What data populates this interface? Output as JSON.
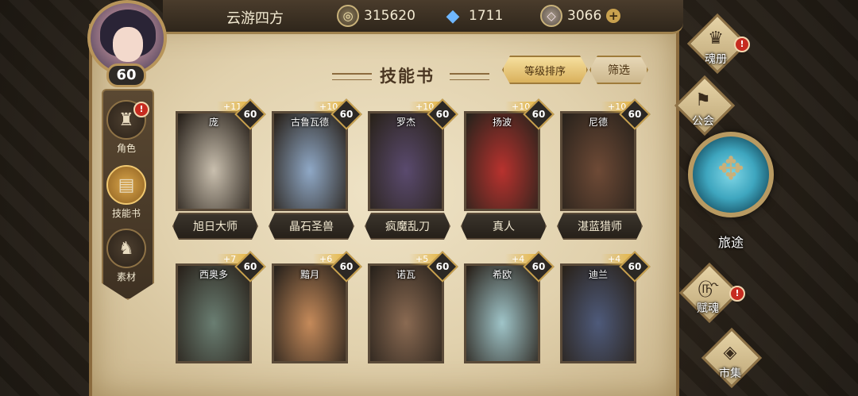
{
  "player": {
    "name": "云游四方",
    "level": "60"
  },
  "resources": {
    "gold": {
      "icon": "coin-icon",
      "value": "315620"
    },
    "crystal": {
      "icon": "blue-crystal-icon",
      "value": "1711"
    },
    "gem": {
      "icon": "gem-icon",
      "value": "3066"
    },
    "plus": "+"
  },
  "side_menu": [
    {
      "label": "角色",
      "icon": "helmet-icon",
      "alert": "!"
    },
    {
      "label": "技能书",
      "icon": "book-icon"
    },
    {
      "label": "素材",
      "icon": "wolf-icon"
    }
  ],
  "page": {
    "title": "技能书",
    "sort_label": "等级排序",
    "filter_label": "筛选"
  },
  "cards": [
    {
      "hero": "庞",
      "plus": "+11",
      "level": "60",
      "book": "旭日大师",
      "color": "#c9bfae"
    },
    {
      "hero": "古鲁瓦德",
      "plus": "+10",
      "level": "60",
      "book": "晶石圣兽",
      "color": "#8fa8c6"
    },
    {
      "hero": "罗杰",
      "plus": "+10",
      "level": "60",
      "book": "疯魔乱刀",
      "color": "#5a4a6e"
    },
    {
      "hero": "扬波",
      "plus": "+10",
      "level": "60",
      "book": "真人",
      "color": "#b8322e"
    },
    {
      "hero": "尼德",
      "plus": "+10",
      "level": "60",
      "book": "湛蓝猎师",
      "color": "#6e4a36"
    },
    {
      "hero": "西奥多",
      "plus": "+7",
      "level": "60",
      "color": "#6a7e72"
    },
    {
      "hero": "黯月",
      "plus": "+6",
      "level": "60",
      "color": "#c58a5a"
    },
    {
      "hero": "诺瓦",
      "plus": "+5",
      "level": "60",
      "color": "#8a6a52"
    },
    {
      "hero": "希欧",
      "plus": "+4",
      "level": "60",
      "color": "#9fc4c8"
    },
    {
      "hero": "迪兰",
      "plus": "+4",
      "level": "60",
      "color": "#4e5a7a"
    }
  ],
  "right_nav": [
    {
      "label": "魂册",
      "icon": "soul-book-icon",
      "alert": "!"
    },
    {
      "label": "公会",
      "icon": "guild-icon"
    },
    {
      "label": "旅途",
      "icon": "journey-emblem-icon"
    },
    {
      "label": "赋魂",
      "icon": "soul-swirl-icon",
      "alert": "!"
    },
    {
      "label": "市集",
      "icon": "market-gem-icon"
    }
  ]
}
